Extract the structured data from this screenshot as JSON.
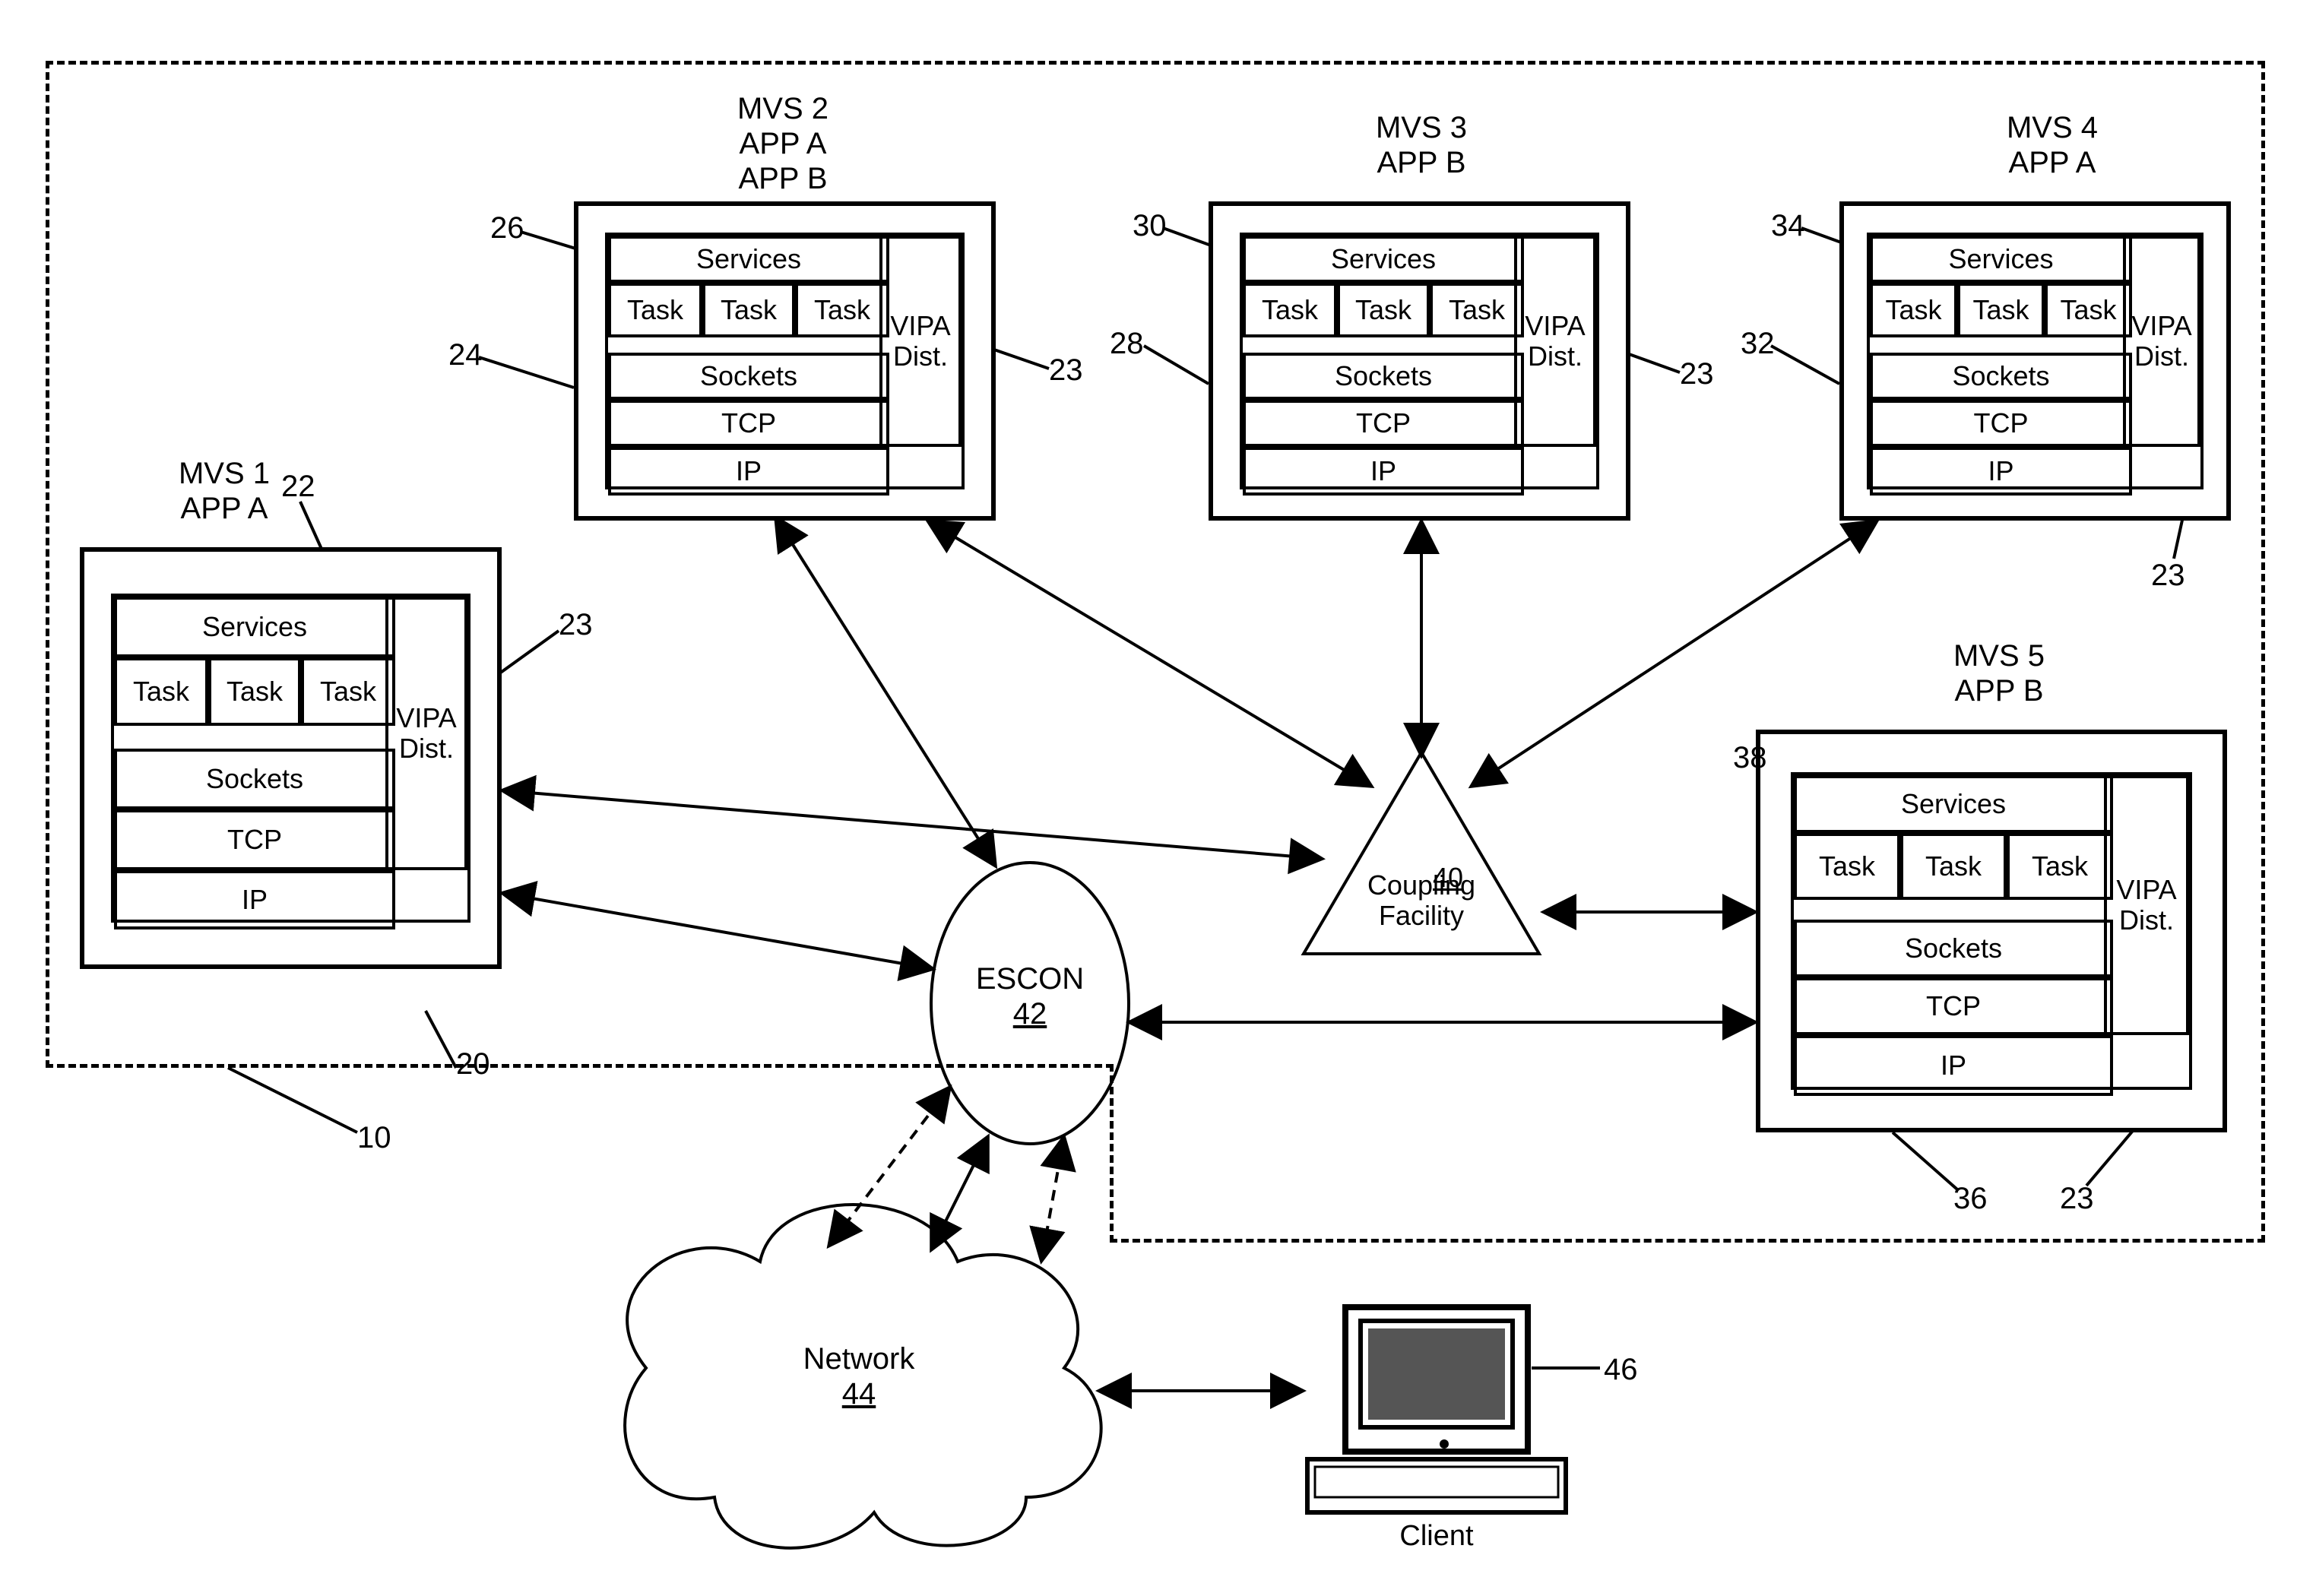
{
  "sysplex_ref": "10",
  "mvs": {
    "m1": {
      "title": "MVS 1\nAPP A",
      "box_ref": "20",
      "stack_ref": "22",
      "vipa_ref": "23"
    },
    "m2": {
      "title": "MVS 2\nAPP A\nAPP B",
      "box_ref": "24",
      "stack_ref": "26",
      "vipa_ref": "23"
    },
    "m3": {
      "title": "MVS 3\nAPP B",
      "box_ref": "28",
      "stack_ref": "30",
      "vipa_ref": "23"
    },
    "m4": {
      "title": "MVS 4\nAPP A",
      "box_ref": "32",
      "stack_ref": "34",
      "vipa_ref": "23"
    },
    "m5": {
      "title": "MVS 5\nAPP B",
      "box_ref": "36",
      "stack_ref": "38",
      "vipa_ref": "23"
    }
  },
  "stack": {
    "services": "Services",
    "task": "Task",
    "sockets": "Sockets",
    "tcp": "TCP",
    "ip": "IP",
    "vipa": "VIPA\nDist."
  },
  "coupling": {
    "ref": "40",
    "label": "Coupling\nFacility"
  },
  "escon": {
    "ref": "42",
    "label": "ESCON"
  },
  "network": {
    "ref": "44",
    "label": "Network"
  },
  "client": {
    "ref": "46",
    "label": "Client"
  }
}
